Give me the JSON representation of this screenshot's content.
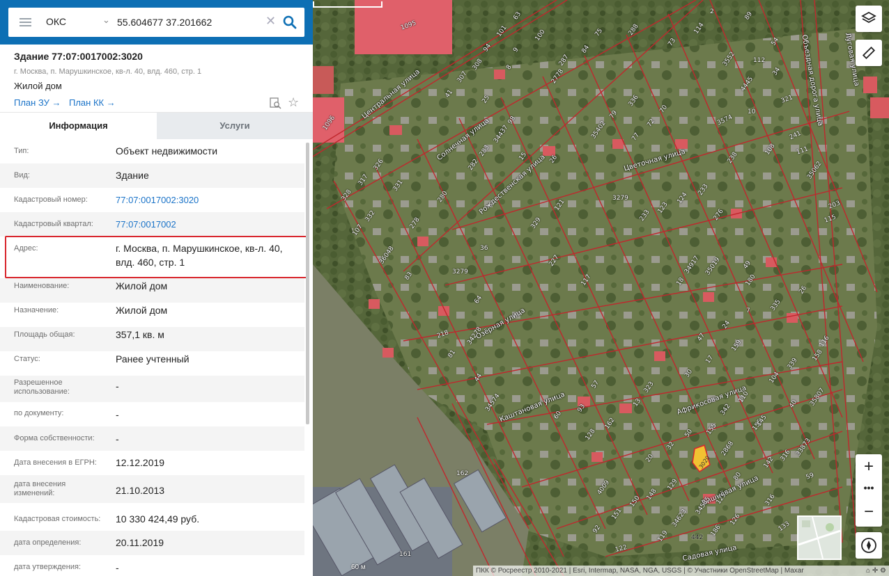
{
  "search": {
    "mode": "ОКС",
    "query": "55.604677 37.201662",
    "clear_icon": "close-icon",
    "search_icon": "search-icon"
  },
  "object": {
    "title": "Здание 77:07:0017002:3020",
    "address": "г. Москва, п. Марушкинское, кв-л. 40, влд. 460, стр. 1",
    "type": "Жилой дом",
    "plan_zu": "План ЗУ →",
    "plan_kk": "План КК →"
  },
  "tabs": {
    "info": "Информация",
    "services": "Услуги"
  },
  "rows": [
    {
      "label": "Тип:",
      "value": "Объект недвижимости"
    },
    {
      "label": "Вид:",
      "value": "Здание"
    },
    {
      "label": "Кадастровый номер:",
      "value": "77:07:0017002:3020"
    },
    {
      "label": "Кадастровый квартал:",
      "value": "77:07:0017002"
    },
    {
      "label": "Адрес:",
      "value": "г. Москва, п. Марушкинское, кв-л. 40, влд. 460, стр. 1"
    },
    {
      "label": "Наименование:",
      "value": "Жилой дом"
    },
    {
      "label": "Назначение:",
      "value": "Жилой дом"
    },
    {
      "label": "Площадь общая:",
      "value": "357,1 кв. м"
    },
    {
      "label": "Статус:",
      "value": "Ранее учтенный"
    },
    {
      "label": "Разрешенное использование:",
      "value": "-"
    },
    {
      "label": "по документу:",
      "value": "-"
    },
    {
      "label": "Форма собственности:",
      "value": "-"
    },
    {
      "label": "Дата внесения в ЕГРН:",
      "value": "12.12.2019"
    },
    {
      "label": "дата внесения изменений:",
      "value": "21.10.2013"
    },
    {
      "label": "Кадастровая стоимость:",
      "value": "10 330 424,49 руб."
    },
    {
      "label": "дата определения:",
      "value": "20.11.2019"
    },
    {
      "label": "дата утверждения:",
      "value": "-"
    }
  ],
  "map": {
    "streets": [
      "Центральная улица",
      "Солнечная улица",
      "Рождественская улица",
      "Цветочная улица",
      "Озёрная улица",
      "Каштановая улица",
      "Африкосовая улица",
      "Вишнёвая улица",
      "Садовая улица",
      "Объездная дорога улица",
      "Луговая улица"
    ],
    "parcels": [
      "1095",
      "1096",
      "101",
      "63",
      "100",
      "94",
      "9",
      "8",
      "308",
      "307",
      "41",
      "25",
      "2778",
      "287",
      "84",
      "75",
      "288",
      "73",
      "2",
      "89",
      "114",
      "54",
      "112",
      "34",
      "321",
      "10",
      "3574",
      "3552",
      "4445",
      "336",
      "70",
      "79",
      "72",
      "77",
      "35402",
      "34437",
      "98",
      "283",
      "282",
      "15",
      "26",
      "3279",
      "233",
      "123",
      "124",
      "233",
      "276",
      "203",
      "115",
      "35062",
      "111",
      "241",
      "108",
      "238",
      "317",
      "328",
      "326",
      "331",
      "280",
      "278",
      "107",
      "332",
      "36048",
      "83",
      "3279",
      "36",
      "329",
      "121",
      "227",
      "117",
      "64",
      "218",
      "34278",
      "81",
      "44",
      "34574",
      "60",
      "93",
      "128",
      "162",
      "161",
      "162",
      "122",
      "92",
      "151",
      "4009",
      "150",
      "148",
      "129",
      "20",
      "32",
      "50",
      "155",
      "2868",
      "342",
      "110",
      "155",
      "145",
      "104",
      "40",
      "35807",
      "339",
      "158",
      "116",
      "33873",
      "142",
      "316",
      "316",
      "59",
      "133",
      "80",
      "125",
      "126",
      "186",
      "34585",
      "34623",
      "119",
      "442",
      "323",
      "13",
      "57",
      "30",
      "17",
      "159",
      "24",
      "47",
      "7",
      "335",
      "26",
      "49",
      "35019",
      "34917",
      "18",
      "180"
    ],
    "highlighted_parcel": "3020",
    "scale_label": "60 м",
    "attribution": "ПКК © Росреестр 2010-2021 | Esri, Intermap, NASA, NGA, USGS | © Участники OpenStreetMap | Maxar",
    "zoom_in": "+",
    "zoom_more": "•••",
    "zoom_out": "−"
  },
  "colors": {
    "accent": "#0d6fb4",
    "link": "#1a73c8",
    "parcel_border": "#c0272d",
    "highlight": "#d8262d",
    "selected": "#f2c232"
  }
}
